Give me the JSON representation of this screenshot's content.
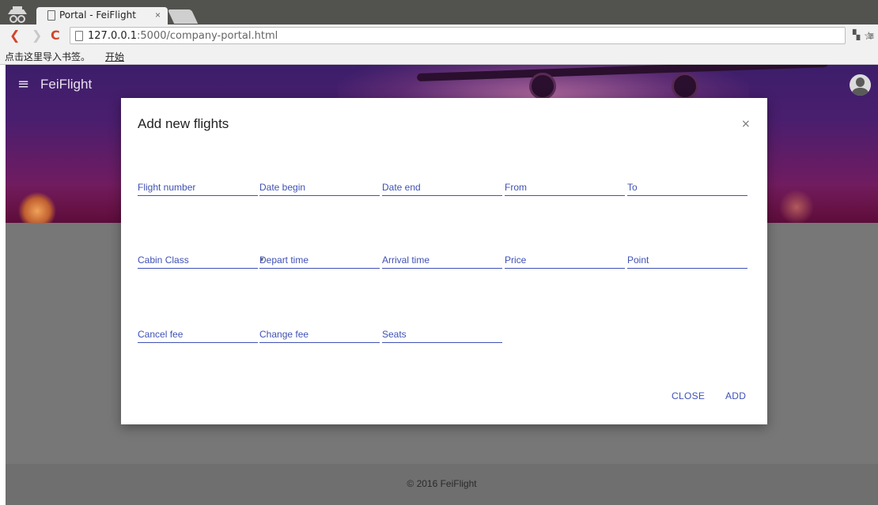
{
  "browser": {
    "tab_title": "Portal - FeiFlight",
    "tab_close": "×",
    "url_host": "127.0.0.1",
    "url_path": ":5000/company-portal.html",
    "bookmarks_text": "点击这里导入书签。",
    "bookmarks_link": "开始"
  },
  "app": {
    "menu_icon": "≡",
    "title": "FeiFlight"
  },
  "dialog": {
    "title": "Add new flights",
    "close_icon": "×",
    "fields": {
      "flight_number": "Flight number",
      "date_begin": "Date begin",
      "date_end": "Date end",
      "from": "From",
      "to": "To",
      "cabin_class": "Cabin Class",
      "depart_time": "Depart time",
      "arrival_time": "Arrival time",
      "price": "Price",
      "point": "Point",
      "cancel_fee": "Cancel fee",
      "change_fee": "Change fee",
      "seats": "Seats"
    },
    "actions": {
      "close": "CLOSE",
      "add": "ADD"
    }
  },
  "footer": {
    "copyright": "© 2016 FeiFlight"
  },
  "colors": {
    "accent": "#3f51b5",
    "overlay": "#777777"
  }
}
